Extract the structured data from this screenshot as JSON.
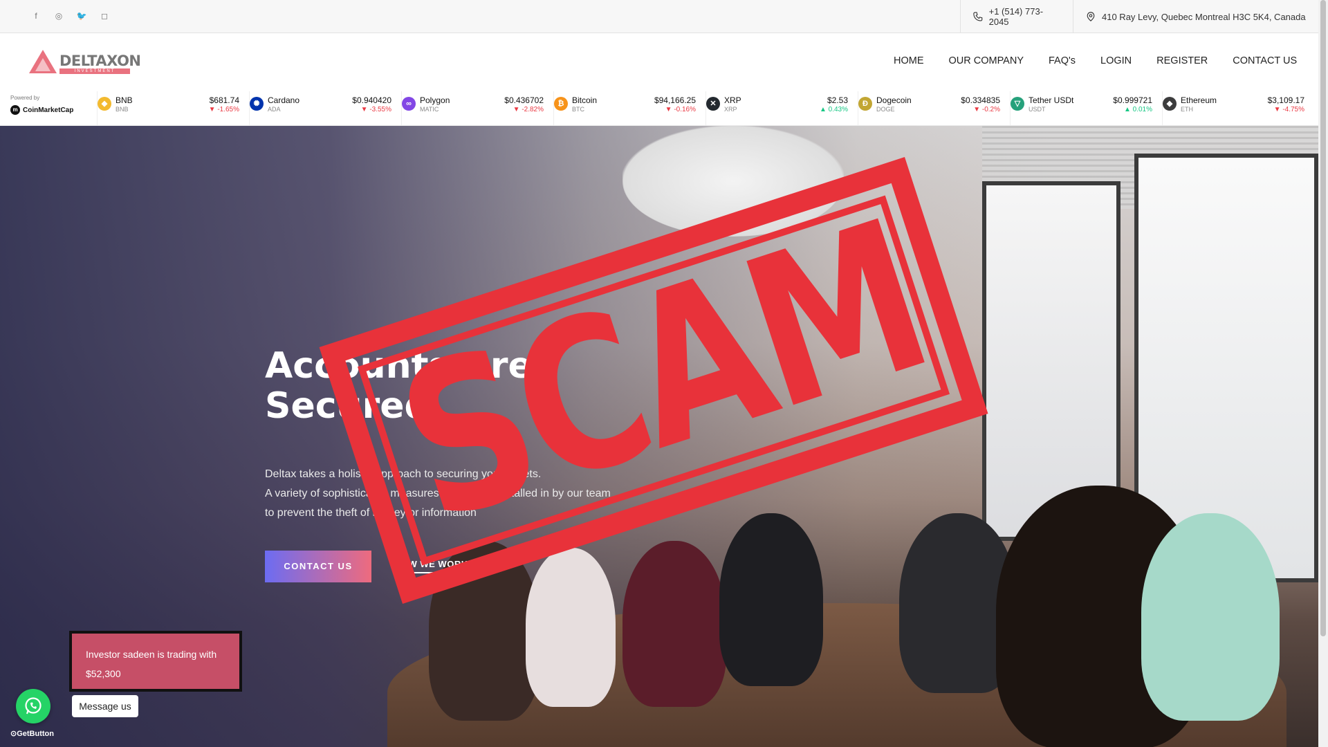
{
  "topbar": {
    "socials": [
      {
        "icon": "facebook-icon",
        "glyph": "f"
      },
      {
        "icon": "dribbble-icon",
        "glyph": "◎"
      },
      {
        "icon": "twitter-icon",
        "glyph": "🐦"
      },
      {
        "icon": "instagram-icon",
        "glyph": "◻"
      }
    ],
    "phone": "+1 (514) 773-2045",
    "address": "410 Ray Levy, Quebec Montreal H3C 5K4, Canada"
  },
  "logo": {
    "name": "DELTAXON",
    "sub": "INVESTMENT"
  },
  "nav": [
    "HOME",
    "OUR COMPANY",
    "FAQ's",
    "LOGIN",
    "REGISTER",
    "CONTACT US"
  ],
  "ticker": {
    "powered_by": "Powered by",
    "provider": "CoinMarketCap",
    "coins": [
      {
        "name": "BNB",
        "symbol": "BNB",
        "price": "$681.74",
        "change": "-1.65%",
        "direction": "down",
        "color": "#f3ba2f",
        "glyph": "◆"
      },
      {
        "name": "Cardano",
        "symbol": "ADA",
        "price": "$0.940420",
        "change": "-3.55%",
        "direction": "down",
        "color": "#0033ad",
        "glyph": "✺"
      },
      {
        "name": "Polygon",
        "symbol": "MATIC",
        "price": "$0.436702",
        "change": "-2.82%",
        "direction": "down",
        "color": "#8247e5",
        "glyph": "∞"
      },
      {
        "name": "Bitcoin",
        "symbol": "BTC",
        "price": "$94,166.25",
        "change": "-0.16%",
        "direction": "down",
        "color": "#f7931a",
        "glyph": "₿"
      },
      {
        "name": "XRP",
        "symbol": "XRP",
        "price": "$2.53",
        "change": "0.43%",
        "direction": "up",
        "color": "#23292f",
        "glyph": "✕"
      },
      {
        "name": "Dogecoin",
        "symbol": "DOGE",
        "price": "$0.334835",
        "change": "-0.2%",
        "direction": "down",
        "color": "#c2a633",
        "glyph": "Ð"
      },
      {
        "name": "Tether USDt",
        "symbol": "USDT",
        "price": "$0.999721",
        "change": "0.01%",
        "direction": "up",
        "color": "#26a17b",
        "glyph": "▽"
      },
      {
        "name": "Ethereum",
        "symbol": "ETH",
        "price": "$3,109.17",
        "change": "-4.75%",
        "direction": "down",
        "color": "#3c3c3d",
        "glyph": "◆"
      }
    ]
  },
  "hero": {
    "title_line1": "Accounts Are",
    "title_line2": "Secured.",
    "text_line1": "Deltax takes a holistic approach to securing your assets.",
    "text_line2": "A variety of sophisticated measures have been installed in by our team",
    "text_line3": "to prevent the theft of money or information",
    "contact_button": "CONTACT US",
    "how_button": "HOW WE WORK"
  },
  "stamp": {
    "text": "SCAM",
    "color": "#e8323a"
  },
  "notification": {
    "text_line1": "Investor sadeen is trading with",
    "text_line2": "$52,300"
  },
  "whatsapp": {
    "label": "Message us",
    "brand": "GetButton"
  }
}
